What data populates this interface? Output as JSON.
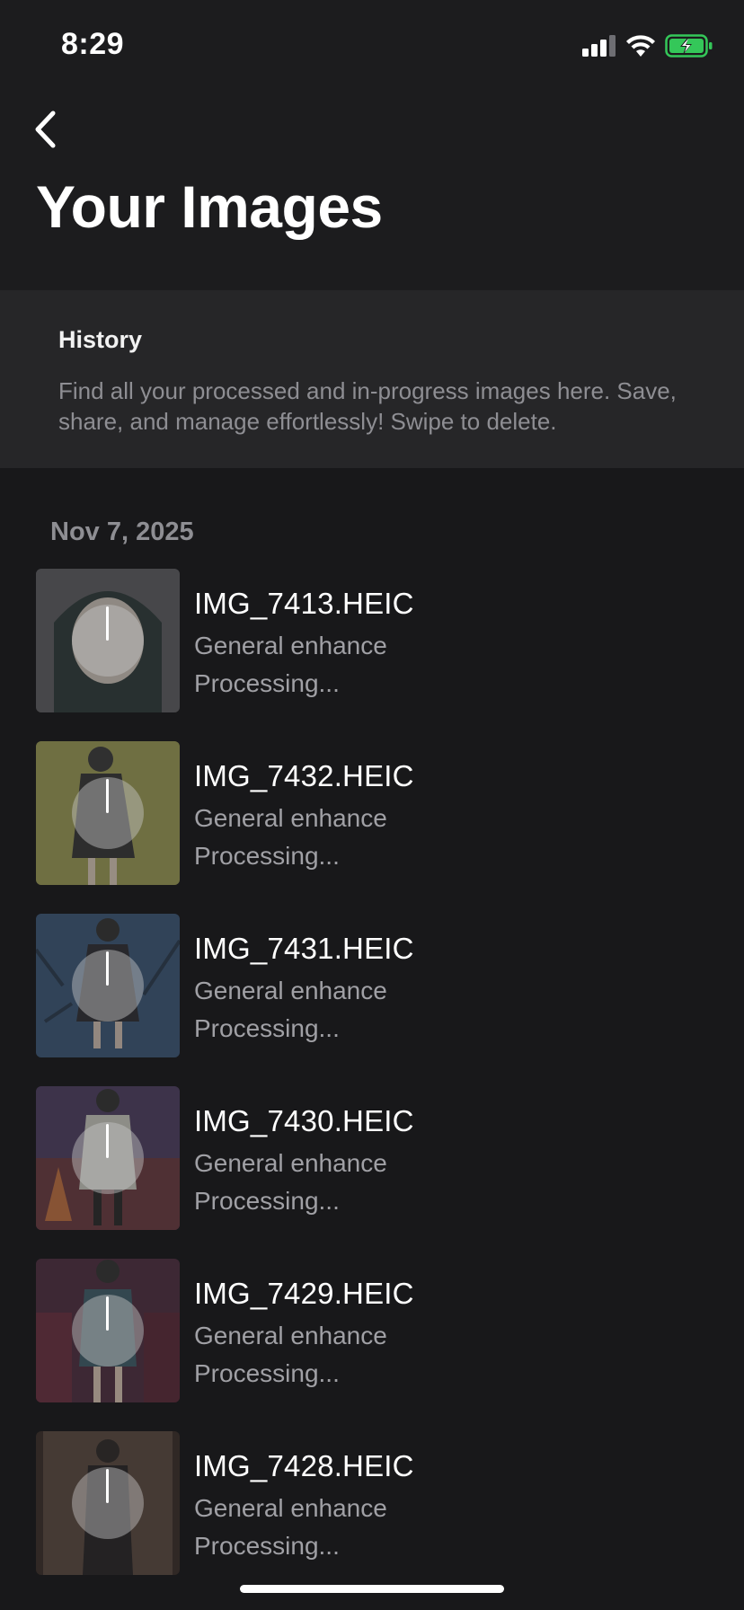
{
  "status_bar": {
    "time": "8:29",
    "icons": [
      "cellular-signal-icon",
      "wifi-icon",
      "battery-charging-icon"
    ],
    "battery_color": "#34c759"
  },
  "header": {
    "back_icon": "chevron-left-icon",
    "title": "Your Images"
  },
  "history": {
    "title": "History",
    "description": "Find all your processed and in-progress images here. Save, share, and manage effortlessly! Swipe to delete."
  },
  "groups": [
    {
      "date": "Nov 7, 2025",
      "items": [
        {
          "name": "IMG_7413.HEIC",
          "type": "General enhance",
          "status": "Processing...",
          "thumb_color": "#5a5a5e"
        },
        {
          "name": "IMG_7432.HEIC",
          "type": "General enhance",
          "status": "Processing...",
          "thumb_color": "#9a9a4a"
        },
        {
          "name": "IMG_7431.HEIC",
          "type": "General enhance",
          "status": "Processing...",
          "thumb_color": "#2e4a6e"
        },
        {
          "name": "IMG_7430.HEIC",
          "type": "General enhance",
          "status": "Processing...",
          "thumb_color": "#5a3048"
        },
        {
          "name": "IMG_7429.HEIC",
          "type": "General enhance",
          "status": "Processing...",
          "thumb_color": "#4a2238"
        },
        {
          "name": "IMG_7428.HEIC",
          "type": "General enhance",
          "status": "Processing...",
          "thumb_color": "#3a2a24"
        }
      ]
    }
  ]
}
